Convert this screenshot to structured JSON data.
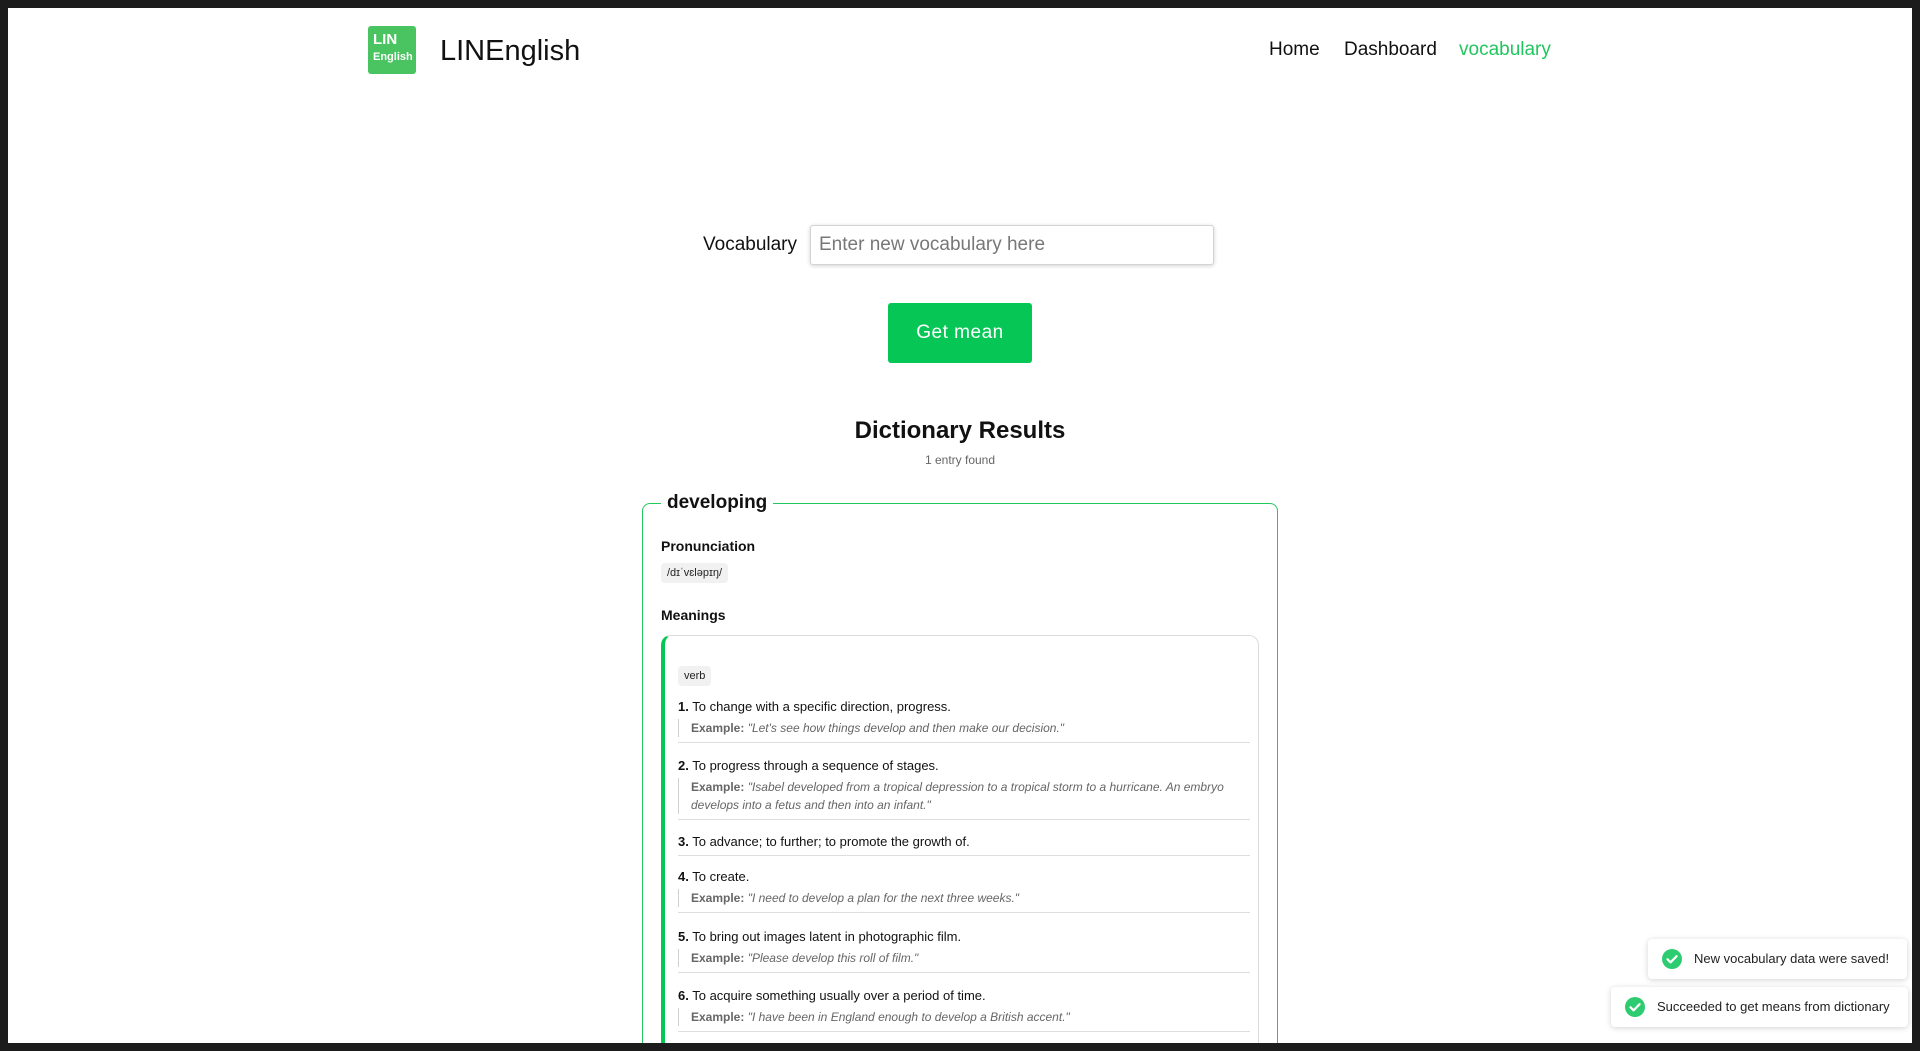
{
  "header": {
    "logo_line1": "LIN",
    "logo_line2": "English",
    "brand": "LINEnglish",
    "nav": {
      "home": "Home",
      "dashboard": "Dashboard",
      "vocabulary": "vocabulary"
    },
    "active_color": "#22c55e"
  },
  "search": {
    "label": "Vocabulary",
    "placeholder": "Enter new vocabulary here",
    "value": "",
    "button": "Get mean",
    "button_color": "#06c755"
  },
  "results": {
    "title": "Dictionary Results",
    "count": "1 entry found",
    "entry": {
      "word": "developing",
      "pronunciation_label": "Pronunciation",
      "pronunciation": "/dɪˈvɛləpɪŋ/",
      "meanings_label": "Meanings",
      "part_of_speech": "verb",
      "example_label": "Example:",
      "definitions": [
        {
          "num": "1.",
          "text": "To change with a specific direction, progress.",
          "example": "\"Let's see how things develop and then make our decision.\""
        },
        {
          "num": "2.",
          "text": "To progress through a sequence of stages.",
          "example": "\"Isabel developed from a tropical depression to a tropical storm to a hurricane.   An embryo develops into a fetus and then into an infant.\""
        },
        {
          "num": "3.",
          "text": "To advance; to further; to promote the growth of.",
          "example": ""
        },
        {
          "num": "4.",
          "text": "To create.",
          "example": "\"I need to develop a plan for the next three weeks.\""
        },
        {
          "num": "5.",
          "text": "To bring out images latent in photographic film.",
          "example": "\"Please develop this roll of film.\""
        },
        {
          "num": "6.",
          "text": "To acquire something usually over a period of time.",
          "example": "\"I have been in England enough to develop a British accent.\""
        }
      ]
    }
  },
  "toasts": [
    {
      "text": "New vocabulary data were saved!"
    },
    {
      "text": "Succeeded to get means from dictionary"
    }
  ]
}
